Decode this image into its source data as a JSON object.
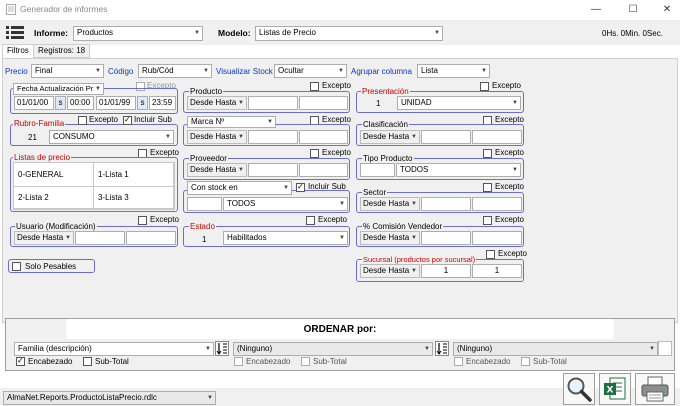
{
  "window": {
    "title": "Generador de informes",
    "minimize": "—",
    "maximize": "☐",
    "close": "✕"
  },
  "toolbar": {
    "informe_label": "Informe:",
    "informe_value": "Productos",
    "modelo_label": "Modelo:",
    "modelo_value": "Listas de Precio",
    "timer": "0Hs. 0Min. 0Sec."
  },
  "tabs": {
    "filtros": "Filtros",
    "registros": "Registros: 18"
  },
  "filters_row": {
    "precio_label": "Precio",
    "precio_value": "Final",
    "codigo_label": "Código",
    "codigo_value": "Rub/Cód",
    "visualizar_label": "Visualizar Stock",
    "visualizar_value": "Ocultar",
    "agrupar_label": "Agrupar columna",
    "agrupar_value": "Lista"
  },
  "common": {
    "excepto": "Excepto",
    "desde_hasta": "Desde Hasta",
    "incluir_sub": "Incluir Sub"
  },
  "fecha": {
    "title": "Fecha Actualización Pr",
    "from_date": "01/01/00",
    "from_time": "00:00",
    "to_date": "01/01/99",
    "to_time": "23:59",
    "s": "s"
  },
  "rubro": {
    "title": "Rubro-Familia",
    "code": "21",
    "value": "CONSUMO"
  },
  "listas": {
    "title": "Listas de precio",
    "items": [
      "0-GENERAL",
      "1-Lista 1",
      "2-Lista 2",
      "3-Lista 3"
    ]
  },
  "usuario": {
    "title": "Usuario (Modificación)"
  },
  "solo_pesables": "Solo Pesables",
  "producto": {
    "title": "Producto"
  },
  "marca": {
    "value": "Marca Nº"
  },
  "proveedor": {
    "title": "Proveedor"
  },
  "stock": {
    "value": "Con stock en",
    "todos": "TODOS"
  },
  "estado": {
    "title": "Estado",
    "code": "1",
    "value": "Habilitados"
  },
  "presentacion": {
    "title": "Presentación",
    "code": "1",
    "value": "UNIDAD"
  },
  "clasificacion": {
    "title": "Clasificación"
  },
  "tipo_producto": {
    "title": "Tipo Producto",
    "value": "TODOS"
  },
  "sector": {
    "title": "Sector"
  },
  "comision": {
    "title": "% Comisión Vendedor"
  },
  "sucursal": {
    "title": "Sucursal (productos por sucursal)",
    "from": "1",
    "to": "1"
  },
  "ordenar": {
    "title": "ORDENAR  por:",
    "col1": "Familia (descripción)",
    "col2": "(Ninguno)",
    "col3": "(Ninguno)",
    "encabezado": "Encabezado",
    "subtotal": "Sub-Total"
  },
  "footer": {
    "report": "AlmaNet.Reports.ProductoListaPrecio.rdlc"
  }
}
